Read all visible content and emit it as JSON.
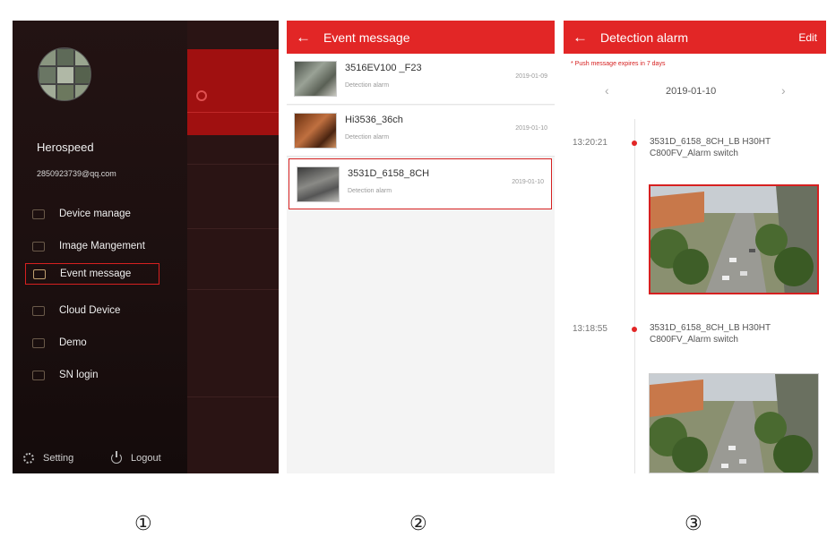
{
  "drawer": {
    "user_name": "Herospeed",
    "user_email": "2850923739@qq.com",
    "menu": [
      {
        "label": "Device manage",
        "icon": "folder-icon"
      },
      {
        "label": "Image Mangement",
        "icon": "image-icon"
      },
      {
        "label": "Event message",
        "icon": "envelope-icon",
        "active": true
      },
      {
        "label": "Cloud Device",
        "icon": "cloud-folder-icon"
      },
      {
        "label": "Demo",
        "icon": "grid-icon"
      },
      {
        "label": "SN login",
        "icon": "sn-icon"
      }
    ],
    "footer": {
      "setting": "Setting",
      "logout": "Logout"
    }
  },
  "event_message": {
    "title": "Event message",
    "items": [
      {
        "name": "3516EV100 _F23",
        "type": "Detection alarm",
        "date": "2019-01-09"
      },
      {
        "name": "Hi3536_36ch",
        "type": "Detection alarm",
        "date": "2019-01-10"
      },
      {
        "name": "3531D_6158_8CH",
        "type": "Detection alarm",
        "date": "2019-01-10"
      }
    ]
  },
  "detection_alarm": {
    "title": "Detection alarm",
    "edit_label": "Edit",
    "notice": "* Push message expires in 7 days",
    "date": "2019-01-10",
    "events": [
      {
        "time": "13:20:21",
        "desc": "3531D_6158_8CH_LB H30HTC800FV_Alarm switch"
      },
      {
        "time": "13:18:55",
        "desc": "3531D_6158_8CH_LB H30HTC800FV_Alarm switch"
      }
    ]
  },
  "step_labels": [
    "①",
    "②",
    "③"
  ],
  "colors": {
    "accent": "#e22626",
    "highlight_border": "#d62020",
    "drawer_bg": "#1a0e0e"
  }
}
